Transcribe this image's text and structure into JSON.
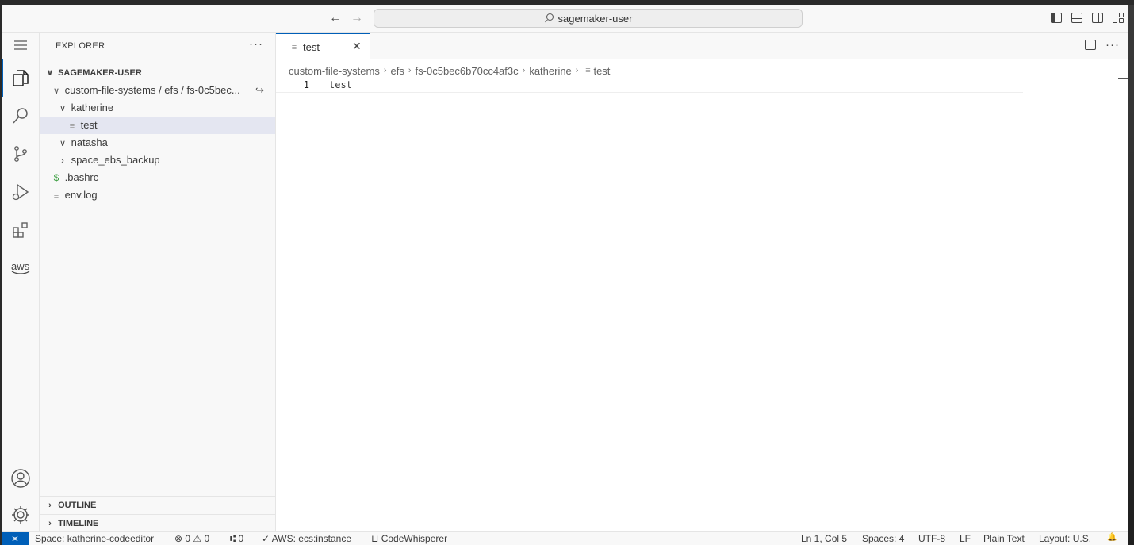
{
  "titlebar": {
    "search_text": "sagemaker-user",
    "back_arrow": "←",
    "forward_arrow": "→"
  },
  "activity_bar": {
    "items": [
      "explorer-icon",
      "search-icon",
      "source-control-icon",
      "run-debug-icon",
      "extensions-icon",
      "aws-icon"
    ],
    "bottom_items": [
      "account-icon",
      "manage-gear-icon"
    ],
    "aws_label": "aws"
  },
  "sidebar": {
    "title": "EXPLORER",
    "more": "···",
    "root": "SAGEMAKER-USER",
    "tree": [
      {
        "label": "custom-file-systems / efs / fs-0c5bec...",
        "chevron": "∨",
        "suffix": "↪"
      },
      {
        "label": "katherine",
        "chevron": "∨"
      },
      {
        "label": "test",
        "glyph": "≡"
      },
      {
        "label": "natasha",
        "chevron": "∨"
      },
      {
        "label": "space_ebs_backup",
        "chevron": "›"
      },
      {
        "label": ".bashrc",
        "glyph": "$"
      },
      {
        "label": "env.log",
        "glyph": "≡"
      }
    ],
    "outline": "OUTLINE",
    "timeline": "TIMELINE"
  },
  "editor": {
    "tab_label": "test",
    "tab_glyph": "≡",
    "tab_close": "✕",
    "more": "···",
    "breadcrumbs": [
      "custom-file-systems",
      "efs",
      "fs-0c5bec6b70cc4af3c",
      "katherine",
      "test"
    ],
    "breadcrumb_sep": "›",
    "lines": [
      {
        "number": "1",
        "text": "test"
      }
    ]
  },
  "statusbar": {
    "remote_glyph": "⪤",
    "space": "Space: katherine-codeeditor",
    "problems": "⊗ 0 ⚠ 0",
    "ports": "⑆ 0",
    "aws": "✓ AWS: ecs:instance",
    "codewhisperer": "⊔ CodeWhisperer",
    "position": "Ln 1, Col 5",
    "spaces": "Spaces: 4",
    "encoding": "UTF-8",
    "eol": "LF",
    "language": "Plain Text",
    "layout": "Layout: U.S.",
    "notifications": "🔔"
  },
  "colors": {
    "accent": "#005fb8",
    "selection": "#e4e6f1",
    "bash_green": "#3e9f43"
  }
}
